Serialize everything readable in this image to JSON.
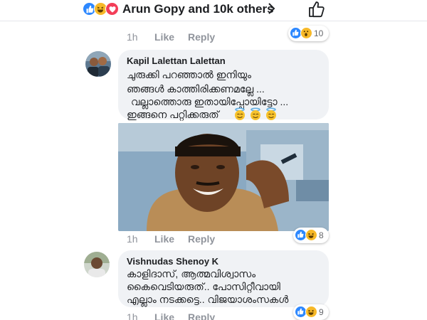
{
  "header": {
    "reactions": [
      "like-reaction",
      "haha-reaction",
      "love-reaction"
    ],
    "names_text": "Arun Gopy and 10k others",
    "colors": {
      "like": "#2d88ff",
      "haha": "#f7b928",
      "love": "#f33e58"
    }
  },
  "first_actions": {
    "time": "1h",
    "like_label": "Like",
    "reply_label": "Reply",
    "reaction_count": "10"
  },
  "comments": [
    {
      "author": "Kapil Lalettan Lalettan",
      "lines": [
        "ചുരുക്കി പറഞ്ഞാൽ ഇനിയും",
        "ഞങ്ങൾ കാത്തിരിക്കണമല്ലേ ...",
        "വല്ലാത്തൊരു ഇതായിപ്പോയിട്ടോ ...",
        "ഇങ്ങനെ പറ്റിക്കരുത്"
      ],
      "time": "1h",
      "like_label": "Like",
      "reply_label": "Reply",
      "reaction_count": "8"
    },
    {
      "author": "Vishnudas Shenoy K",
      "lines": [
        "കാളിദാസ്, ആത്മവിശ്വാസം",
        "കൈവെടിയരുത്.. പോസിറ്റീവായി",
        "എല്ലാം നടക്കട്ടെ.. വിജയാശംസകൾ"
      ],
      "time": "1h",
      "like_label": "Like",
      "reply_label": "Reply",
      "reaction_count": "9"
    }
  ]
}
